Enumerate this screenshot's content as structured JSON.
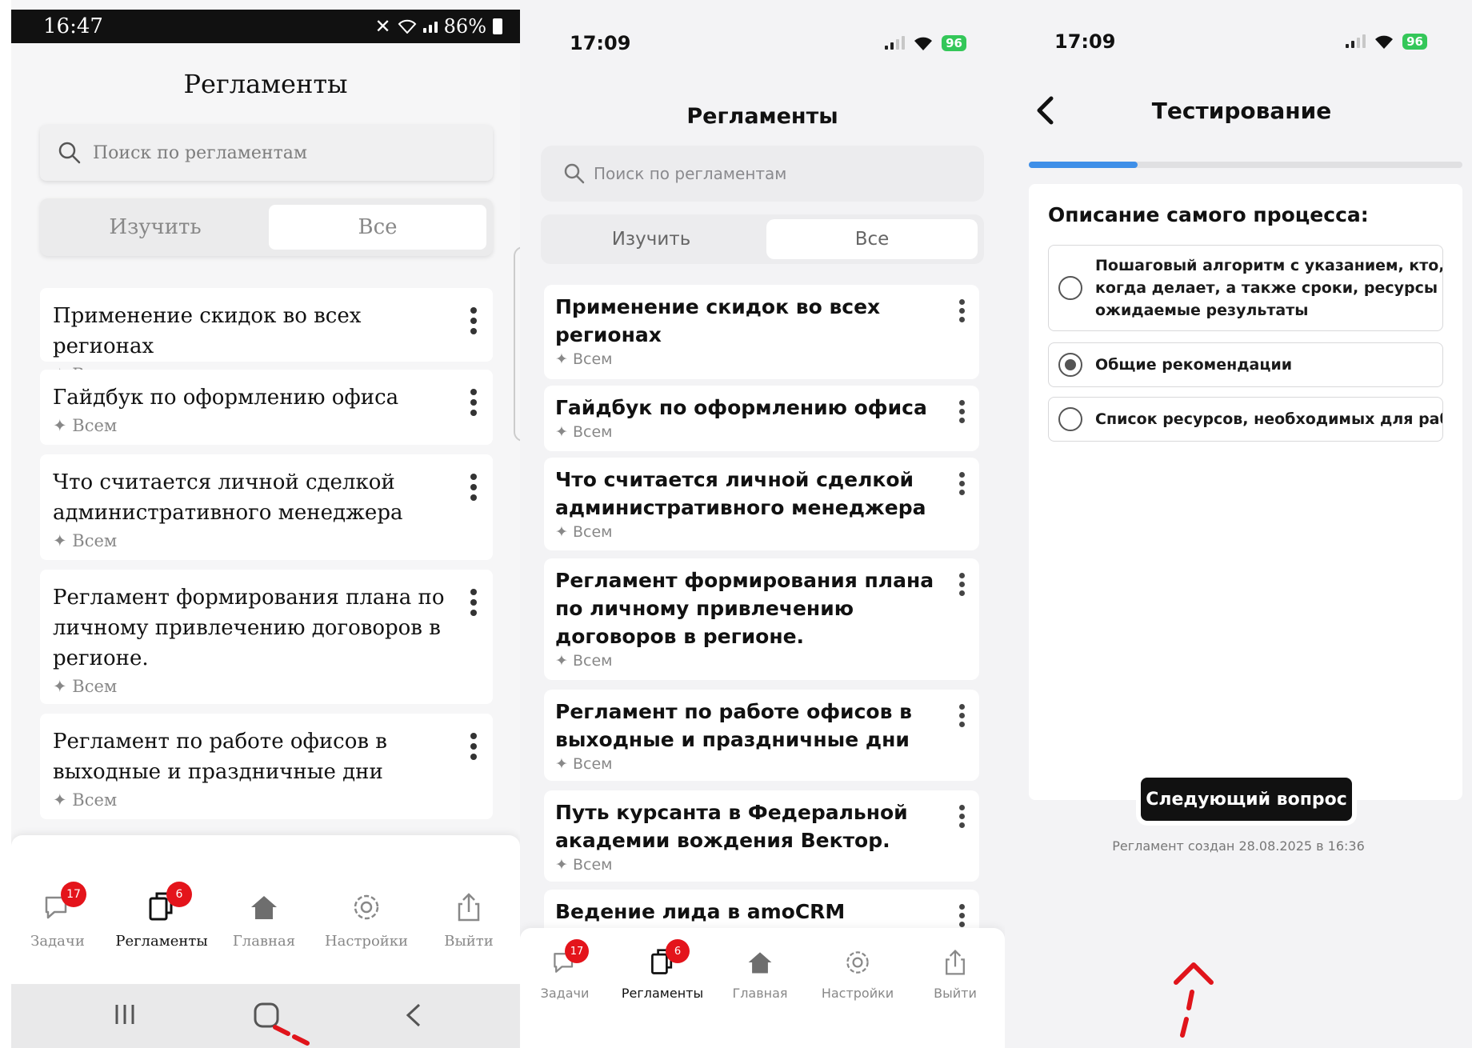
{
  "screens": [
    {
      "status": {
        "time": "16:47",
        "battery": "86%"
      },
      "title": "Регламенты",
      "search_placeholder": "Поиск по регламентам",
      "tabs": [
        "Изучить",
        "Все"
      ],
      "items": [
        {
          "title": "Применение скидок во всех регионах",
          "meta": "✦ Всем"
        },
        {
          "title": "Гайдбук по оформлению офиса",
          "meta": "✦ Всем"
        },
        {
          "title": "Что считается личной сделкой административного менеджера",
          "meta": "✦ Всем"
        },
        {
          "title": "Регламент формирования плана по личному привлечению договоров в регионе.",
          "meta": "✦ Всем"
        },
        {
          "title": "Регламент по работе офисов  в выходные и праздничные дни",
          "meta": "✦ Всем"
        }
      ],
      "nav": [
        {
          "label": "Задачи",
          "badge": "17"
        },
        {
          "label": "Регламенты",
          "badge": "6"
        },
        {
          "label": "Главная"
        },
        {
          "label": "Настройки"
        },
        {
          "label": "Выйти"
        }
      ],
      "system_nav": [
        "recents-icon",
        "home-icon",
        "back-icon"
      ]
    },
    {
      "status": {
        "time": "17:09",
        "battery": "96"
      },
      "title": "Регламенты",
      "search_placeholder": "Поиск по регламентам",
      "tabs": [
        "Изучить",
        "Все"
      ],
      "items": [
        {
          "title": "Применение скидок во всех регионах",
          "meta": "✦ Всем"
        },
        {
          "title": "Гайдбук по оформлению офиса",
          "meta": "✦ Всем"
        },
        {
          "title": "Что считается личной сделкой административного менеджера",
          "meta": "✦ Всем"
        },
        {
          "title": "Регламент формирования плана по личному привлечению договоров в регионе.",
          "meta": "✦ Всем"
        },
        {
          "title": "Регламент по работе офисов  в выходные и праздничные дни",
          "meta": "✦ Всем"
        },
        {
          "title": "Путь курсанта в Федеральной академии вождения Вектор.",
          "meta": "✦ Всем"
        },
        {
          "title": "Ведение лида в amoCRM",
          "meta": ""
        }
      ],
      "nav": [
        {
          "label": "Задачи",
          "badge": "17"
        },
        {
          "label": "Регламенты",
          "badge": "6"
        },
        {
          "label": "Главная"
        },
        {
          "label": "Настройки"
        },
        {
          "label": "Выйти"
        }
      ]
    },
    {
      "status": {
        "time": "17:09",
        "battery": "96"
      },
      "title": "Тестирование",
      "progress": 0.25,
      "question": "Описание самого процесса:",
      "options": [
        {
          "text": "Пошаговый алгоритм с указанием, кто, чт\nкогда делает, а также сроки, ресурсы и\nожидаемые результаты",
          "selected": false
        },
        {
          "text": "Общие рекомендации",
          "selected": true
        },
        {
          "text": "Список ресурсов, необходимых для работ",
          "selected": false
        }
      ],
      "next_button": "Следующий вопрос",
      "created": "Регламент создан 28.08.2025 в 16:36"
    }
  ],
  "colors": {
    "badge_red": "#e4141b",
    "progress_blue": "#3f8fe8",
    "battery_green": "#34c759",
    "annotation_red": "#e0141b"
  }
}
